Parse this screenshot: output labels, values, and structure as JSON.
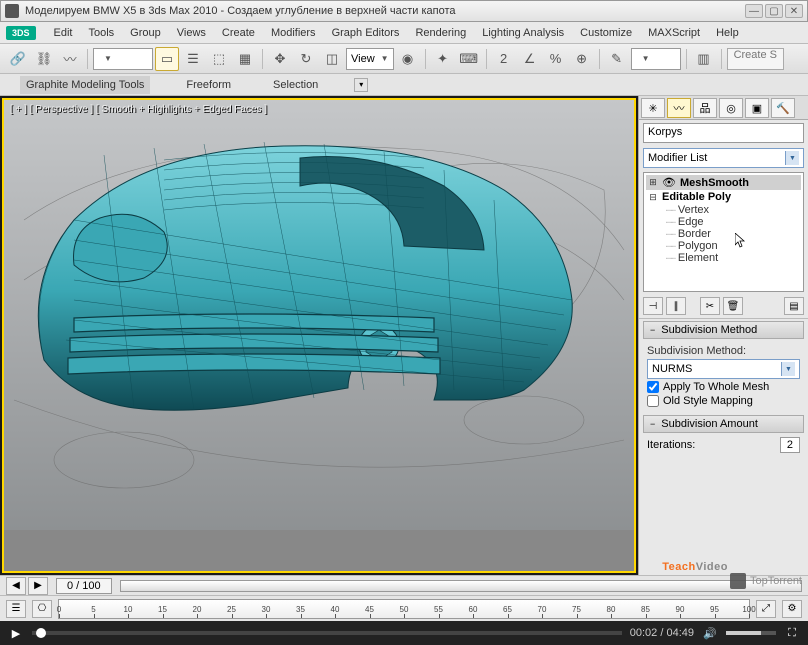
{
  "window": {
    "title": "Моделируем BMW X5 в 3ds Max 2010 - Создаем углубление в верхней части капота"
  },
  "app_logo": "3DS",
  "menu": [
    "Edit",
    "Tools",
    "Group",
    "Views",
    "Create",
    "Modifiers",
    "Graph Editors",
    "Rendering",
    "Lighting Analysis",
    "Customize",
    "MAXScript",
    "Help"
  ],
  "toolbar": {
    "view_dropdown": "View",
    "create_btn": "Create S"
  },
  "ribbon": {
    "tabs": [
      "Graphite Modeling Tools",
      "Freeform",
      "Selection"
    ]
  },
  "viewport": {
    "label": "[ + ] [ Perspective ] [ Smooth + Highlights + Edged Faces ]"
  },
  "rpanel": {
    "object_name": "Korpys",
    "modlist_label": "Modifier List",
    "stack": {
      "top": "MeshSmooth",
      "base": "Editable Poly",
      "subs": [
        "Vertex",
        "Edge",
        "Border",
        "Polygon",
        "Element"
      ]
    },
    "roll1": {
      "title": "Subdivision Method",
      "label": "Subdivision Method:",
      "value": "NURMS",
      "chk1": "Apply To Whole Mesh",
      "chk2": "Old Style Mapping"
    },
    "roll2": {
      "title": "Subdivision Amount",
      "iter_label": "Iterations:",
      "iter_val": "2"
    }
  },
  "status": {
    "frame": "0 / 100"
  },
  "timeline": {
    "ticks": [
      0,
      5,
      10,
      15,
      20,
      25,
      30,
      35,
      40,
      45,
      50,
      55,
      60,
      65,
      70,
      75,
      80,
      85,
      90,
      95,
      100
    ]
  },
  "video": {
    "time": "00:02 / 04:49"
  },
  "watermark": "TopTorrent",
  "teachvideo": {
    "a": "Teach",
    "b": "Video"
  }
}
